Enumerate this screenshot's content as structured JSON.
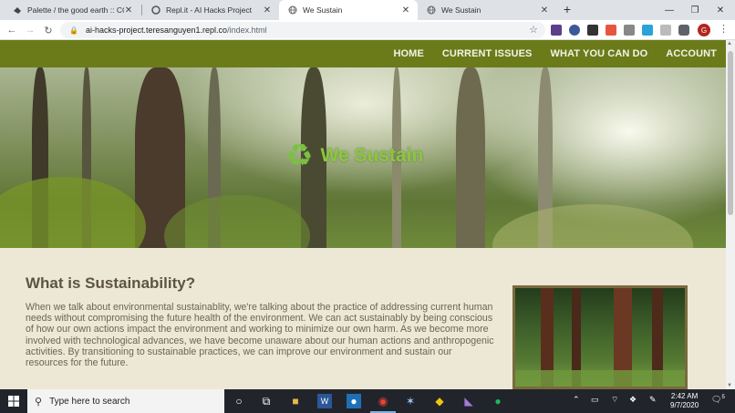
{
  "browser": {
    "tabs": [
      {
        "title": "Palette / the good earth :: COLOU",
        "active": false
      },
      {
        "title": "Repl.it - AI Hacks Project",
        "active": false
      },
      {
        "title": "We Sustain",
        "active": true
      },
      {
        "title": "We Sustain",
        "active": false
      }
    ],
    "new_tab": "+",
    "url_host": "ai-hacks-project.teresanguyen1.repl.co",
    "url_path": "/index.html",
    "profile_initial": "G"
  },
  "site": {
    "nav": [
      "HOME",
      "CURRENT ISSUES",
      "WHAT YOU CAN DO",
      "ACCOUNT"
    ],
    "logo_text": "We Sustain",
    "logo_icon": "recycle-icon",
    "heading": "What is Sustainability?",
    "paragraph": "When we talk about environmental sustainablity, we're talking about the practice of addressing current human needs without compromising the future health of the environment. We can act sustainably by being conscious of how our own actions impact the environment and working to minimize our own harm. As we become more involved with technological advances, we have become unaware about our human actions and anthropogenic activities. By transitioning to sustainable practices, we can improve our environment and sustain our resources for the future.",
    "colors": {
      "navbar": "#6b7b1a",
      "background": "#ede7d6",
      "logo": "#8cc63f"
    }
  },
  "taskbar": {
    "search_placeholder": "Type here to search",
    "time": "2:42 AM",
    "date": "9/7/2020",
    "notification_count": "5"
  }
}
